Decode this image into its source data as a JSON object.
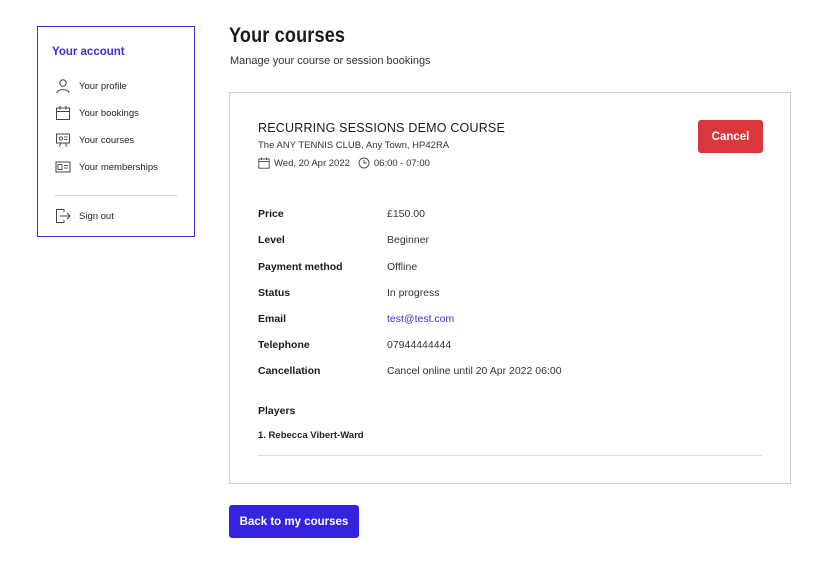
{
  "sidebar": {
    "title": "Your account",
    "items": [
      {
        "label": "Your profile",
        "icon": "user-icon"
      },
      {
        "label": "Your bookings",
        "icon": "calendar-icon"
      },
      {
        "label": "Your courses",
        "icon": "courses-icon"
      },
      {
        "label": "Your memberships",
        "icon": "membership-card-icon"
      }
    ],
    "sign_out": {
      "label": "Sign out",
      "icon": "sign-out-icon"
    }
  },
  "main": {
    "title": "Your courses",
    "subtitle": "Manage your course or session bookings"
  },
  "course": {
    "name": "RECURRING SESSIONS DEMO COURSE",
    "venue": "The ANY TENNIS CLUB, Any Town, HP42RA",
    "date": "Wed, 20 Apr 2022",
    "time": "06:00 - 07:00",
    "cancel_label": "Cancel",
    "details": [
      {
        "key": "Price",
        "value": "£150.00"
      },
      {
        "key": "Level",
        "value": "Beginner"
      },
      {
        "key": "Payment method",
        "value": "Offline"
      },
      {
        "key": "Status",
        "value": "In progress"
      },
      {
        "key": "Email",
        "value": "test@test.com"
      },
      {
        "key": "Telephone",
        "value": "07944444444"
      },
      {
        "key": "Cancellation",
        "value": "Cancel online until 20 Apr 2022 06:00"
      }
    ],
    "players_heading": "Players",
    "players": [
      "1.  Rebecca Vibert-Ward"
    ]
  },
  "back_button_label": "Back to my courses",
  "colors": {
    "accent": "#3b2fd1",
    "cancel": "#d9373b",
    "back_button": "#3424e0"
  }
}
